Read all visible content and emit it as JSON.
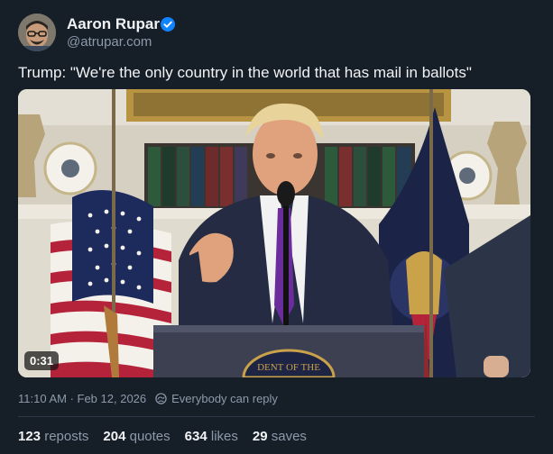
{
  "author": {
    "name": "Aaron Rupar",
    "handle": "@atrupar.com",
    "verified": true
  },
  "post": {
    "text": "Trump: \"We're the only country in the world that has mail in ballots\"",
    "video": {
      "duration": "0:31",
      "seal_text": "DENT OF THE"
    },
    "timestamp": "11:10 AM · Feb 12, 2026",
    "reply_setting": "Everybody can reply"
  },
  "stats": [
    {
      "count": "123",
      "label": "reposts"
    },
    {
      "count": "204",
      "label": "quotes"
    },
    {
      "count": "634",
      "label": "likes"
    },
    {
      "count": "29",
      "label": "saves"
    }
  ],
  "colors": {
    "background": "#161e27",
    "text": "#f1f3f5",
    "muted": "#8c9aab",
    "verified": "#1083fe",
    "divider": "#2c3846"
  }
}
